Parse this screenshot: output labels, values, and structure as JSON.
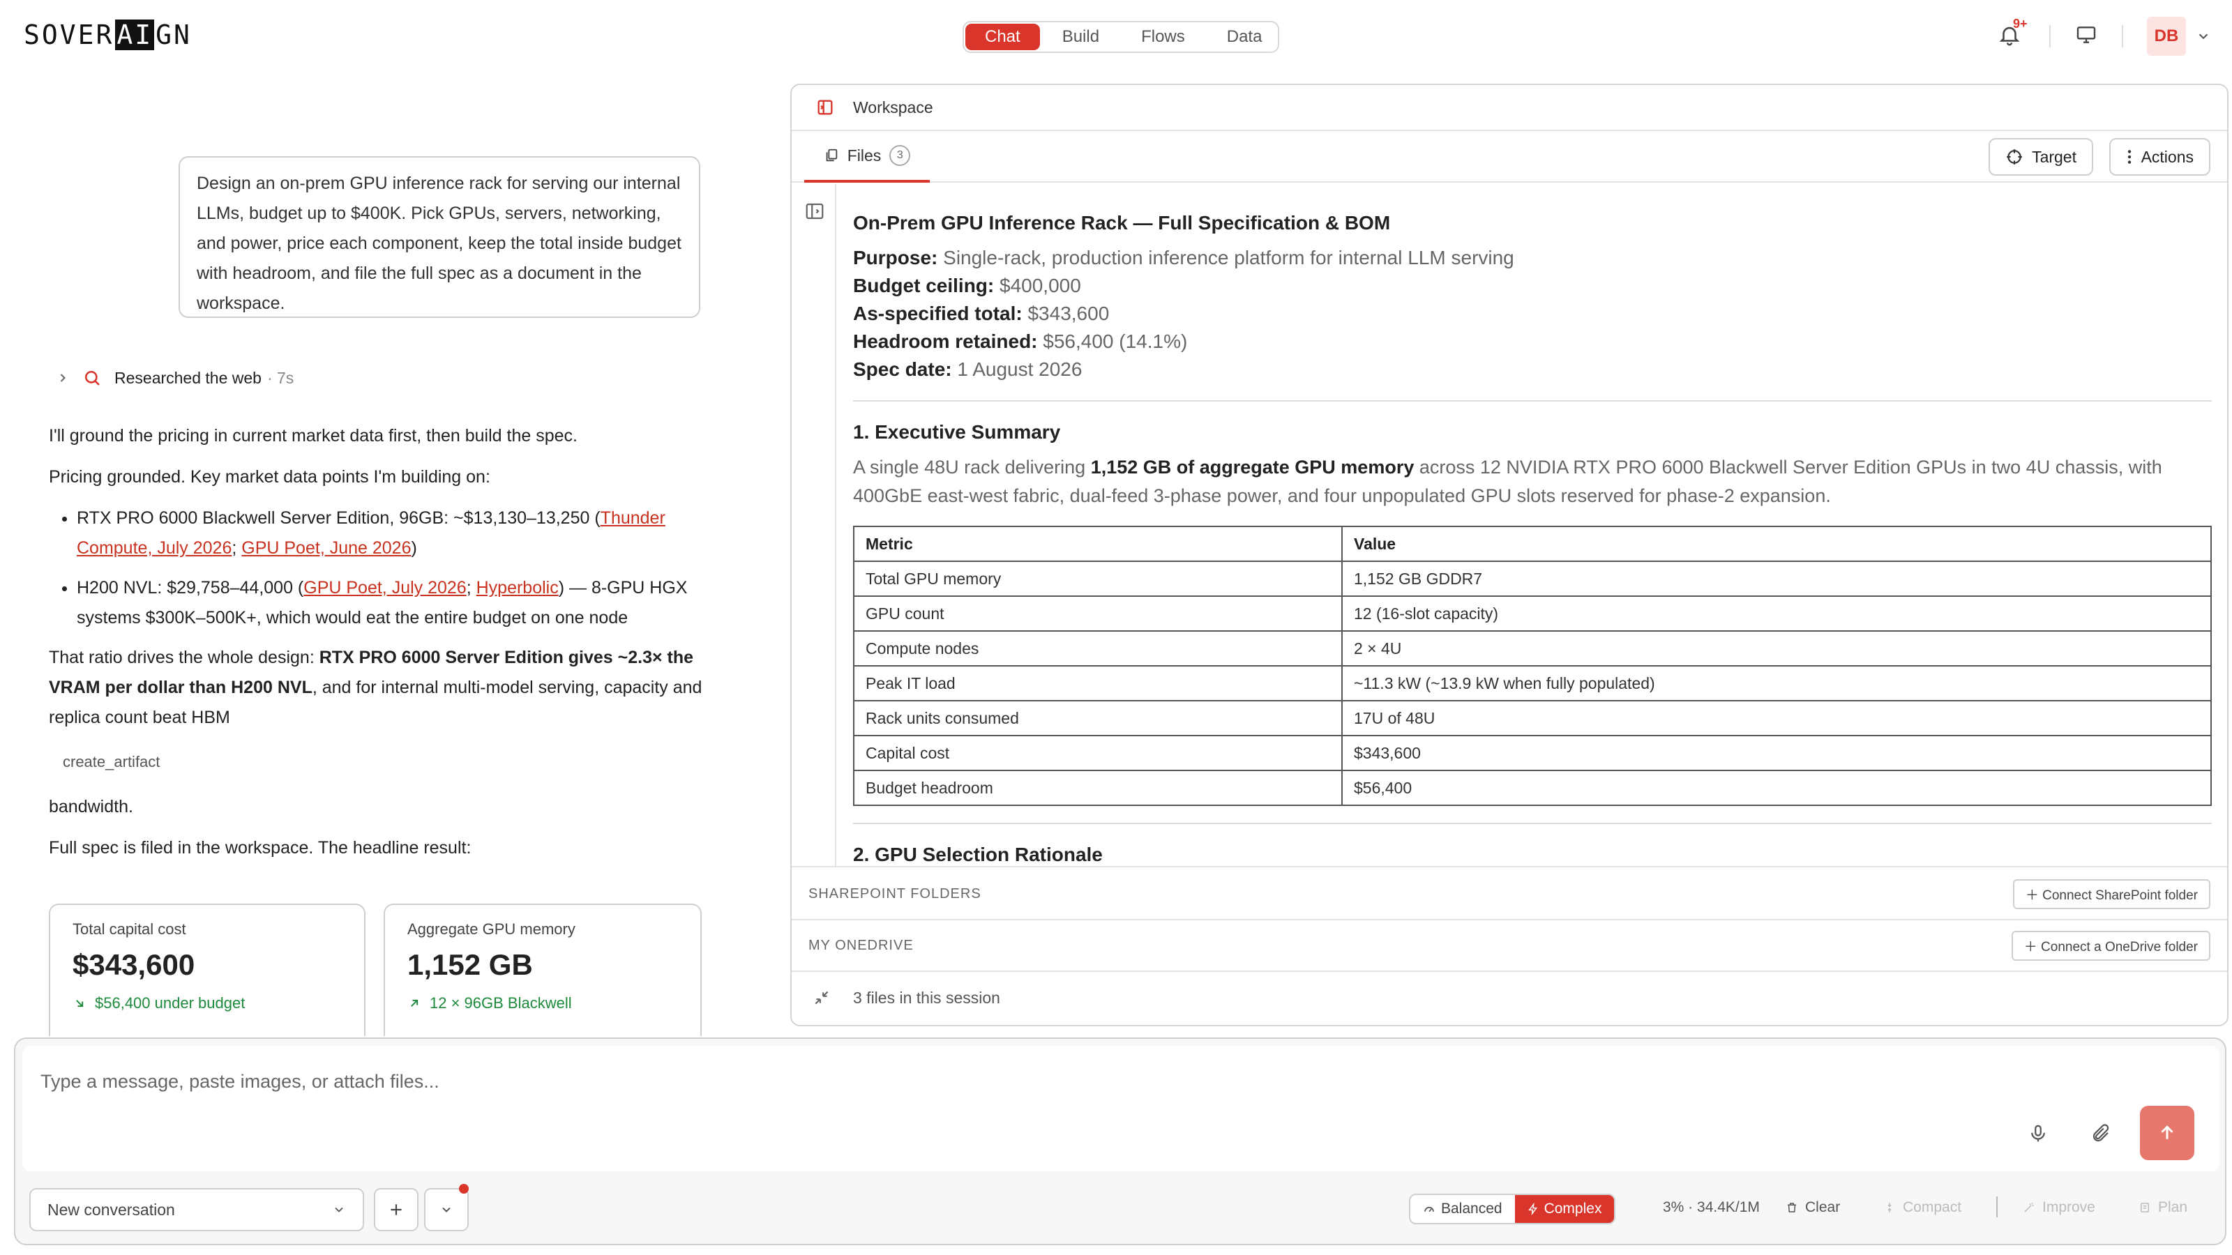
{
  "header": {
    "logo": {
      "before": "SOVER",
      "highlight": "AI",
      "after": "GN"
    },
    "nav": [
      "Chat",
      "Build",
      "Flows",
      "Data"
    ],
    "active_nav": "Chat",
    "notification_count": "9+",
    "user_initials": "DB"
  },
  "chat": {
    "user_message": "Design an on-prem GPU inference rack for serving our internal LLMs, budget up to $400K. Pick GPUs, servers, networking, and power, price each component, keep the total inside budget with headroom, and file the full spec as a document in the workspace.",
    "research_label": "Researched the web",
    "research_time": "· 7s",
    "p1": "I'll ground the pricing in current market data first, then build the spec.",
    "p2": "Pricing grounded. Key market data points I'm building on:",
    "b1_text": "RTX PRO 6000 Blackwell Server Edition, 96GB: ~$13,130–13,250 (",
    "b1_link1": "Thunder Compute, July 2026",
    "b1_sep": "; ",
    "b1_link2": "GPU Poet, June 2026",
    "b1_end": ")",
    "b2_text": "H200 NVL: $29,758–44,000 (",
    "b2_link1": "GPU Poet, July 2026",
    "b2_sep": "; ",
    "b2_link2": "Hyperbolic",
    "b2_end": ") — 8-GPU HGX systems $300K–500K+, which would eat the entire budget on one node",
    "p3_pre": "That ratio drives the whole design: ",
    "p3_bold": "RTX PRO 6000 Server Edition gives ~2.3× the VRAM per dollar than H200 NVL",
    "p3_post": ", and for internal multi-model serving, capacity and replica count beat HBM",
    "tool_call": "create_artifact",
    "p4": "bandwidth.",
    "p5": "Full spec is filed in the workspace. The headline result:",
    "cards": [
      {
        "title": "Total capital cost",
        "value": "$343,600",
        "delta": "$56,400 under budget"
      },
      {
        "title": "Aggregate GPU memory",
        "value": "1,152 GB",
        "delta": "12 × 96GB Blackwell"
      }
    ]
  },
  "workspace": {
    "title": "Workspace",
    "files_tab": "Files",
    "files_count": "3",
    "target_label": "Target",
    "actions_label": "Actions",
    "doc": {
      "title": "On-Prem GPU Inference Rack — Full Specification & BOM",
      "meta": [
        {
          "k": "Purpose:",
          "v": "Single-rack, production inference platform for internal LLM serving"
        },
        {
          "k": "Budget ceiling:",
          "v": "$400,000"
        },
        {
          "k": "As-specified total:",
          "v": "$343,600"
        },
        {
          "k": "Headroom retained:",
          "v": "$56,400 (14.1%)"
        },
        {
          "k": "Spec date:",
          "v": "1 August 2026"
        }
      ],
      "s1_title": "1. Executive Summary",
      "s1_pre": "A single 48U rack delivering ",
      "s1_bold": "1,152 GB of aggregate GPU memory",
      "s1_post": " across 12 NVIDIA RTX PRO 6000 Blackwell Server Edition GPUs in two 4U chassis, with 400GbE east-west fabric, dual-feed 3-phase power, and four unpopulated GPU slots reserved for phase-2 expansion.",
      "table_headers": [
        "Metric",
        "Value"
      ],
      "table_rows": [
        [
          "Total GPU memory",
          "1,152 GB GDDR7"
        ],
        [
          "GPU count",
          "12 (16-slot capacity)"
        ],
        [
          "Compute nodes",
          "2 × 4U"
        ],
        [
          "Peak IT load",
          "~11.3 kW (~13.9 kW when fully populated)"
        ],
        [
          "Rack units consumed",
          "17U of 48U"
        ],
        [
          "Capital cost",
          "$343,600"
        ],
        [
          "Budget headroom",
          "$56,400"
        ]
      ],
      "s2_title": "2. GPU Selection Rationale"
    },
    "sharepoint_label": "SHAREPOINT FOLDERS",
    "sharepoint_btn": "Connect SharePoint folder",
    "onedrive_label": "MY ONEDRIVE",
    "onedrive_btn": "Connect a OneDrive folder",
    "footer": "3 files in this session"
  },
  "composer": {
    "placeholder": "Type a message, paste images, or attach files...",
    "conversation": "New conversation",
    "mode_balanced": "Balanced",
    "mode_complex": "Complex",
    "usage": "3% · 34.4K/1M",
    "clear": "Clear",
    "compact": "Compact",
    "improve": "Improve",
    "plan": "Plan"
  },
  "colors": {
    "accent": "#d9352b",
    "positive": "#1e8a3c",
    "link": "#c8321f"
  }
}
